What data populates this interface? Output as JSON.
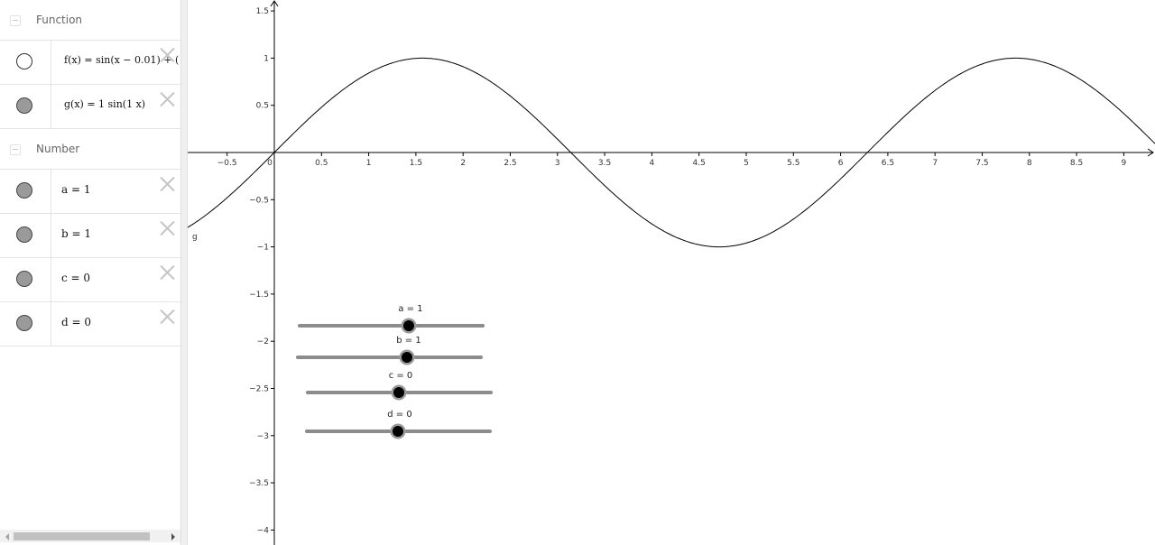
{
  "algebra": {
    "groups": [
      {
        "label": "Function",
        "items": [
          {
            "text": "f(x)  =  sin(x − 0.01) + (",
            "visible": false
          },
          {
            "text": "g(x)  =  1  sin(1 x)",
            "visible": true
          }
        ]
      },
      {
        "label": "Number",
        "items": [
          {
            "text": "a  =  1",
            "visible": true
          },
          {
            "text": "b  =  1",
            "visible": true
          },
          {
            "text": "c  =  0",
            "visible": true
          },
          {
            "text": "d  =  0",
            "visible": true
          }
        ]
      }
    ]
  },
  "graphics": {
    "curve_label": "g",
    "curve_function": "g(x) = 1 sin(1 x)",
    "x_axis": {
      "range": [
        -0.9,
        9.3
      ],
      "tick_step": 0.5,
      "tick_labels": [
        "−0.5",
        "0",
        "0.5",
        "1",
        "1.5",
        "2",
        "2.5",
        "3",
        "3.5",
        "4",
        "4.5",
        "5",
        "5.5",
        "6",
        "6.5",
        "7",
        "7.5",
        "8",
        "8.5",
        "9"
      ]
    },
    "y_axis": {
      "range": [
        -4.05,
        1.6
      ],
      "tick_step": 0.5,
      "tick_labels": [
        "1.5",
        "1",
        "0.5",
        "−0.5",
        "−1",
        "−1.5",
        "−2",
        "−2.5",
        "−3",
        "−3.5",
        "−4"
      ]
    },
    "sliders": [
      {
        "name": "a",
        "label": "a = 1",
        "value": 1,
        "fraction": 0.6
      },
      {
        "name": "b",
        "label": "b = 1",
        "value": 1,
        "fraction": 0.6
      },
      {
        "name": "c",
        "label": "c = 0",
        "value": 0,
        "fraction": 0.5
      },
      {
        "name": "d",
        "label": "d = 0",
        "value": 0,
        "fraction": 0.5
      }
    ],
    "colors": {
      "curve": "#000000",
      "axis": "#000000",
      "slider_track": "#8c8c8c",
      "slider_knob": "#000000",
      "slider_halo": "#9a9a9a"
    }
  }
}
